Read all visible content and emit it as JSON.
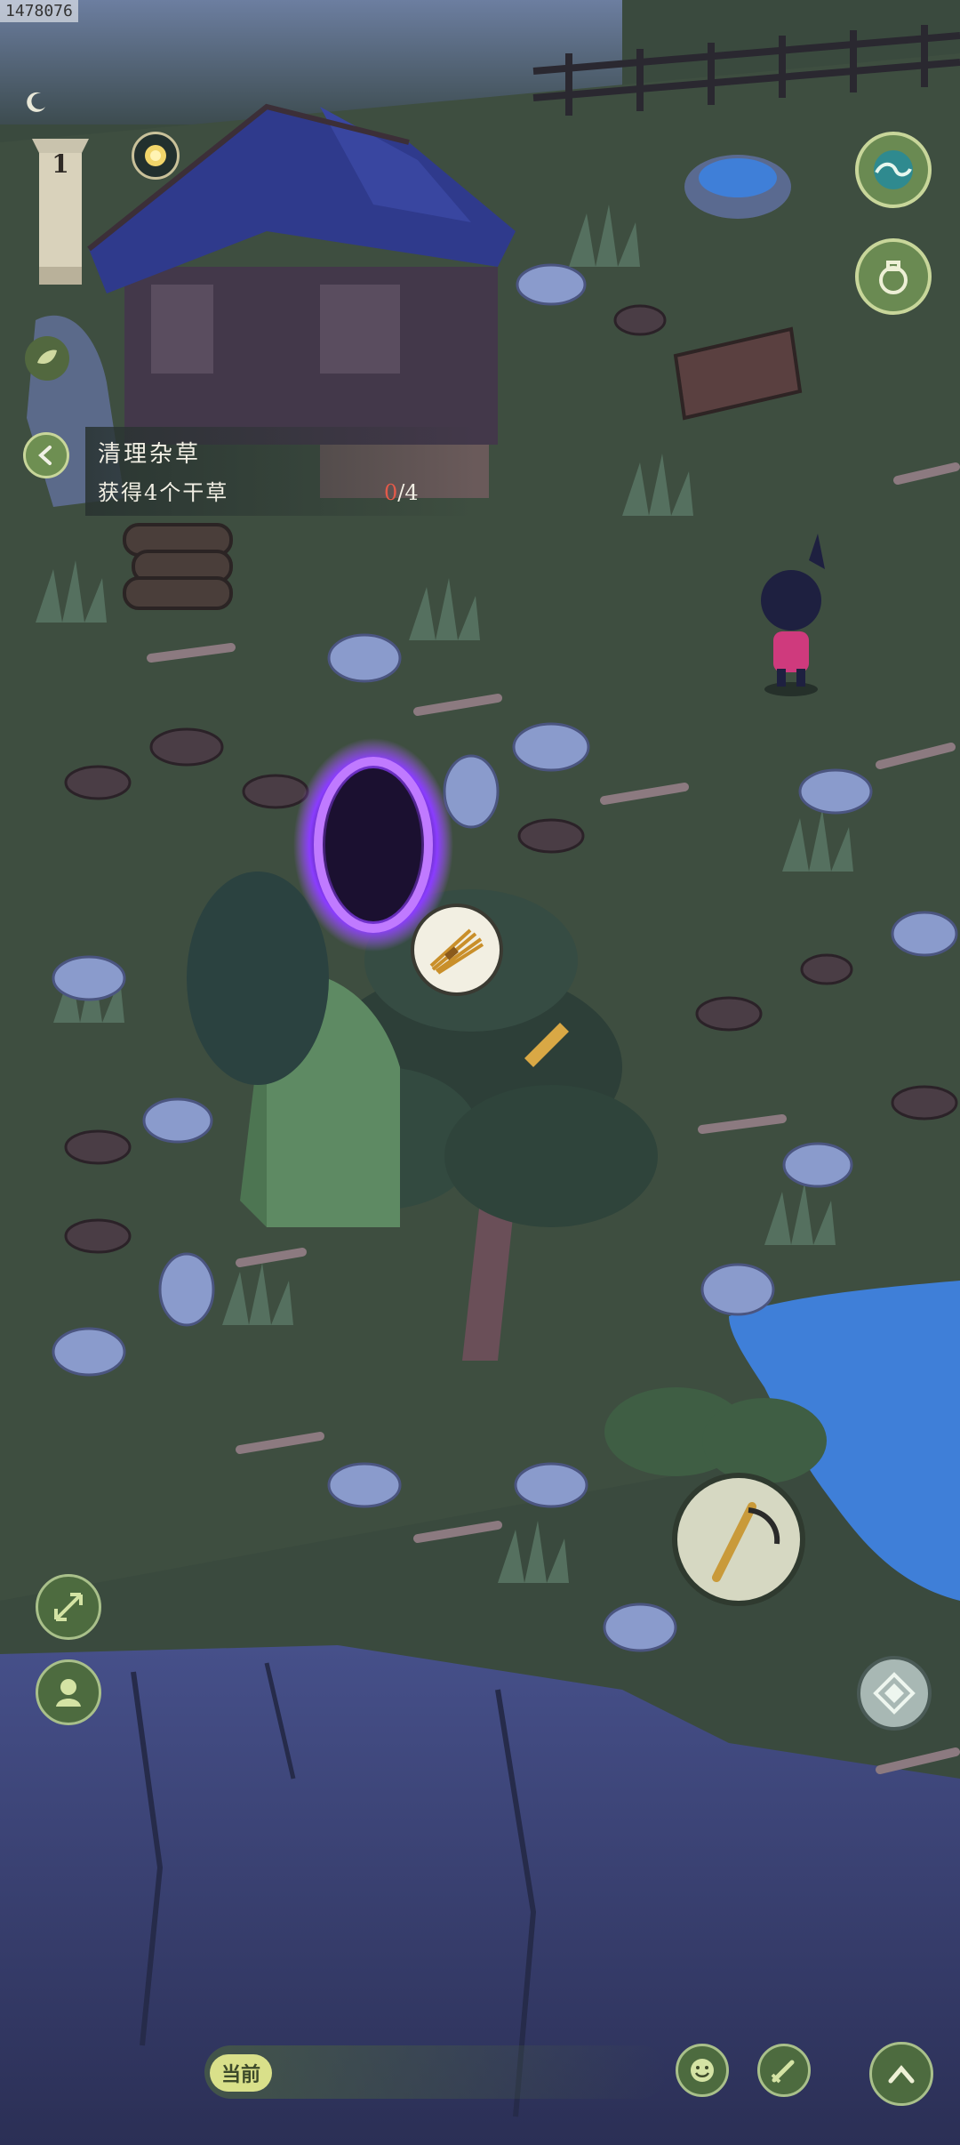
{
  "screen": {
    "debug_id": "1478076"
  },
  "hud": {
    "level": "1",
    "moon_icon": "crescent-moon-icon",
    "sun_icon": "sun-coin-icon",
    "leaf_icon": "leaf-icon",
    "back_icon": "chevron-left-icon"
  },
  "quest": {
    "title": "清理杂草",
    "description": "获得4个干草",
    "progress_current": "0",
    "progress_separator": "/",
    "progress_total": "4"
  },
  "right_buttons": {
    "wave_icon": "wave-icon",
    "pouch_icon": "pouch-icon",
    "compass_icon": "compass-icon"
  },
  "left_buttons": {
    "expand_icon": "expand-arrows-icon",
    "character_icon": "character-icon"
  },
  "action": {
    "tool_icon": "scythe-icon"
  },
  "world_marker": {
    "icon": "hay-bundle-icon"
  },
  "bottom": {
    "current_label": "当前",
    "emote_icon": "smile-icon",
    "edit_icon": "brush-icon",
    "up_icon": "chevron-up-icon"
  },
  "colors": {
    "grass": "#3b4a3d",
    "water": "#3f7fd8",
    "cliff": "#3b4474",
    "portal": "#a24cff",
    "hud_green": "#6a8a52",
    "progress_red": "#e25a4a"
  }
}
